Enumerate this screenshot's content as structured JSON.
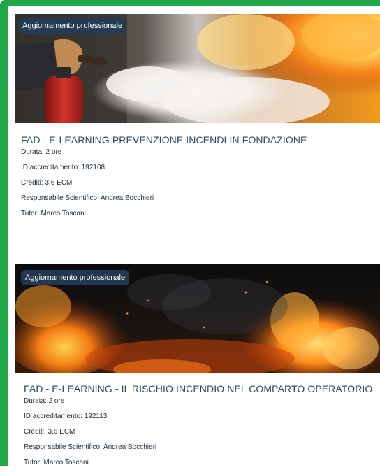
{
  "cards": [
    {
      "badge": "Aggiornamento professionale",
      "title": "FAD - E-LEARNING PREVENZIONE INCENDI IN FONDAZIONE",
      "durata_label": "Durata:",
      "durata": "2 ore",
      "id_label": "ID accreditamento:",
      "id": "192108",
      "crediti_label": "Crediti:",
      "crediti": "3,6 ECM",
      "resp_label": "Responsabile Scientifico:",
      "resp": "Andrea Bocchieri",
      "tutor_label": "Tutor:",
      "tutor": "Marco Toscani"
    },
    {
      "badge": "Aggiornamento professionale",
      "title": "FAD - E-LEARNING - IL RISCHIO INCENDIO NEL COMPARTO OPERATORIO",
      "durata_label": "Durata:",
      "durata": "2 ore",
      "id_label": "ID accreditamento:",
      "id": "192113",
      "crediti_label": "Crediti:",
      "crediti": "3,6 ECM",
      "resp_label": "Responsabile Scientifico:",
      "resp": "Andrea Bocchieri",
      "tutor_label": "Tutor:",
      "tutor": "Marco Toscani"
    }
  ],
  "colors": {
    "frame_green": "#1fa74a",
    "title_blue": "#2b4867",
    "badge_bg": "#233c55"
  }
}
